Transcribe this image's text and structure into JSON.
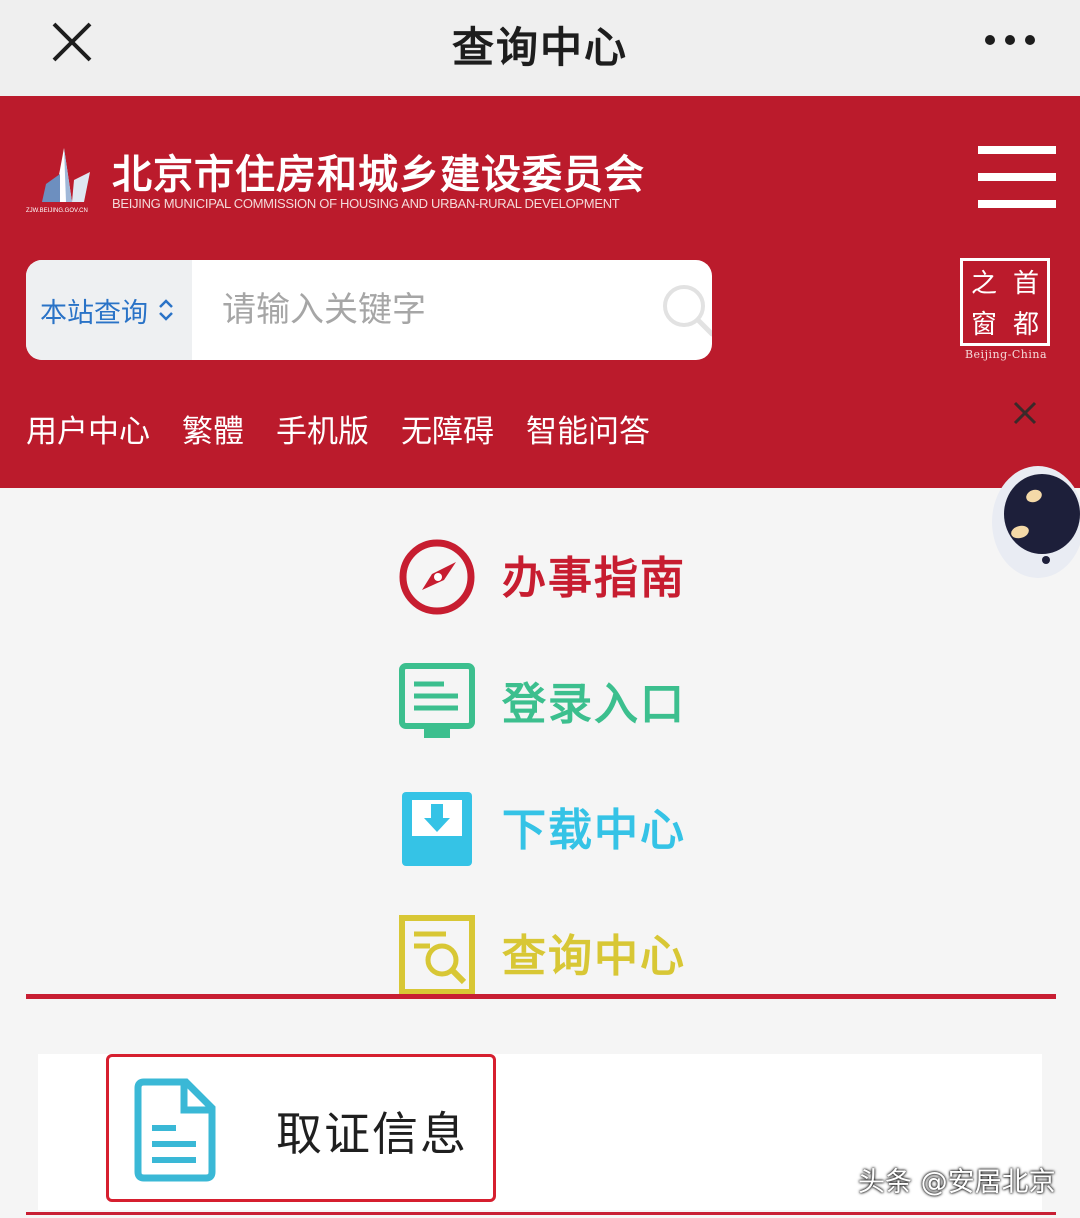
{
  "topbar": {
    "title": "查询中心"
  },
  "header": {
    "org_name_cn": "北京市住房和城乡建设委员会",
    "org_name_en": "BEIJING MUNICIPAL COMMISSION OF HOUSING AND URBAN-RURAL DEVELOPMENT",
    "logo_caption": "ZJW.BEIJING.GOV.CN",
    "seal": {
      "chars": [
        "之",
        "首",
        "窗",
        "都"
      ],
      "caption": "Beijing-China"
    }
  },
  "search": {
    "scope_label": "本站查询",
    "placeholder": "请输入关键字"
  },
  "nav": {
    "items": [
      "用户中心",
      "繁體",
      "手机版",
      "无障碍",
      "智能问答"
    ]
  },
  "menu": {
    "items": [
      {
        "label": "办事指南",
        "icon": "compass-icon",
        "color": "#c71d30"
      },
      {
        "label": "登录入口",
        "icon": "login-screen-icon",
        "color": "#3cbf8e"
      },
      {
        "label": "下载中心",
        "icon": "download-tray-icon",
        "color": "#35c3e6"
      },
      {
        "label": "查询中心",
        "icon": "search-document-icon",
        "color": "#d8c735"
      }
    ]
  },
  "card": {
    "label": "取证信息",
    "icon": "document-icon"
  },
  "watermark": "头条 @安居北京",
  "colors": {
    "brand_red": "#bb1b2c",
    "link_blue": "#2a73c7",
    "highlight_red": "#d61f2f"
  }
}
